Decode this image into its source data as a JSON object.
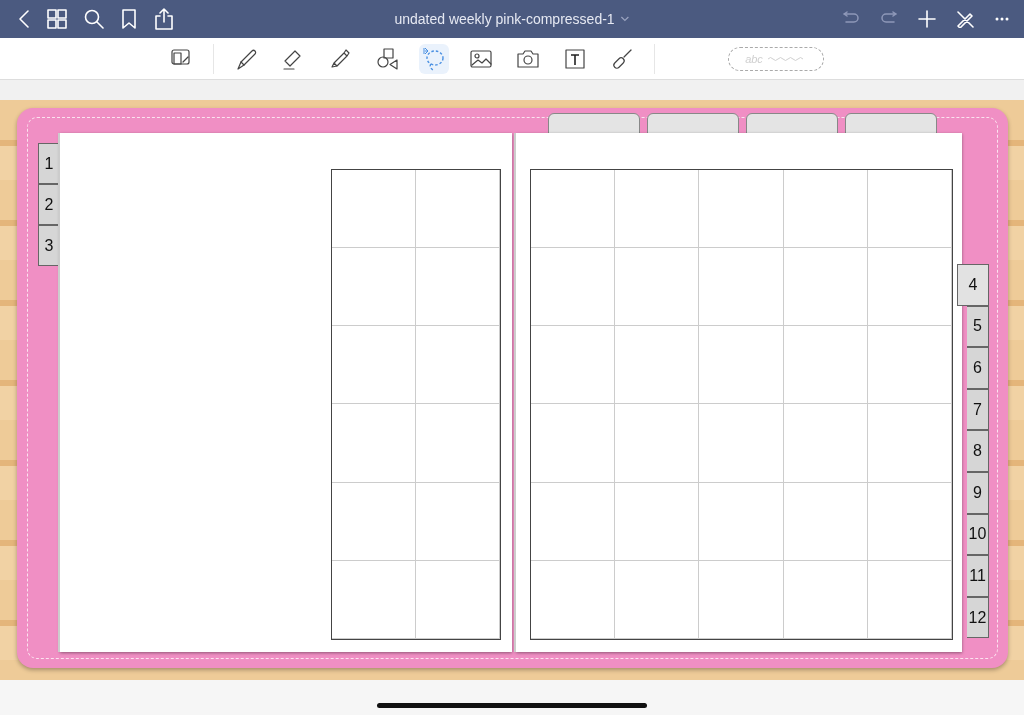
{
  "nav": {
    "title": "undated weekly pink-compressed-1"
  },
  "tools": [
    {
      "kind": "page",
      "selected": false
    },
    {
      "kind": "pen",
      "selected": false
    },
    {
      "kind": "eraser",
      "selected": false
    },
    {
      "kind": "highlighter",
      "selected": false
    },
    {
      "kind": "shapes",
      "selected": false
    },
    {
      "kind": "lasso",
      "selected": true
    },
    {
      "kind": "image",
      "selected": false
    },
    {
      "kind": "camera",
      "selected": false
    },
    {
      "kind": "text",
      "selected": false
    },
    {
      "kind": "laser",
      "selected": false
    }
  ],
  "handwriting_box": {
    "placeholder": "abc"
  },
  "left_tabs": [
    {
      "label": "1",
      "selected": false
    },
    {
      "label": "2",
      "selected": false
    },
    {
      "label": "3",
      "selected": false
    }
  ],
  "right_tabs": [
    {
      "label": "4",
      "selected": true
    },
    {
      "label": "5",
      "selected": false
    },
    {
      "label": "6",
      "selected": false
    },
    {
      "label": "7",
      "selected": false
    },
    {
      "label": "8",
      "selected": false
    },
    {
      "label": "9",
      "selected": false
    },
    {
      "label": "10",
      "selected": false
    },
    {
      "label": "11",
      "selected": false
    },
    {
      "label": "12",
      "selected": false
    }
  ]
}
